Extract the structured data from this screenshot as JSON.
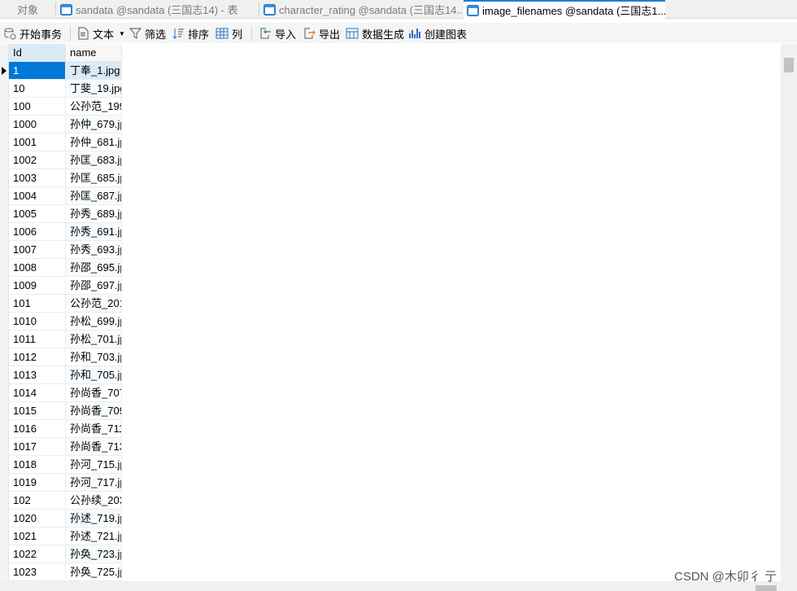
{
  "tabs": [
    {
      "label": "对象",
      "active": false,
      "icon": "none"
    },
    {
      "label": "sandata @sandata (三国志14) - 表",
      "active": false,
      "icon": "table-icon"
    },
    {
      "label": "character_rating @sandata (三国志14...",
      "active": false,
      "icon": "table-icon"
    },
    {
      "label": "image_filenames @sandata (三国志1...",
      "active": true,
      "icon": "table-icon"
    }
  ],
  "toolbar": {
    "begin_transaction": "开始事务",
    "text": "文本",
    "filter": "筛选",
    "sort": "排序",
    "columns": "列",
    "import": "导入",
    "export": "导出",
    "data_generation": "数据生成",
    "create_chart": "创建图表"
  },
  "grid": {
    "columns": [
      "Id",
      "name"
    ],
    "rows": [
      [
        "1",
        "丁奉_1.jpg"
      ],
      [
        "10",
        "丁斐_19.jpg"
      ],
      [
        "100",
        "公孙范_199"
      ],
      [
        "1000",
        "孙仲_679.jp"
      ],
      [
        "1001",
        "孙仲_681.jp"
      ],
      [
        "1002",
        "孙匡_683.jp"
      ],
      [
        "1003",
        "孙匡_685.jp"
      ],
      [
        "1004",
        "孙匡_687.jp"
      ],
      [
        "1005",
        "孙秀_689.jp"
      ],
      [
        "1006",
        "孙秀_691.jp"
      ],
      [
        "1007",
        "孙秀_693.jp"
      ],
      [
        "1008",
        "孙邵_695.jp"
      ],
      [
        "1009",
        "孙邵_697.jp"
      ],
      [
        "101",
        "公孙范_201"
      ],
      [
        "1010",
        "孙松_699.jp"
      ],
      [
        "1011",
        "孙松_701.jp"
      ],
      [
        "1012",
        "孙和_703.jp"
      ],
      [
        "1013",
        "孙和_705.jp"
      ],
      [
        "1014",
        "孙尚香_707"
      ],
      [
        "1015",
        "孙尚香_709"
      ],
      [
        "1016",
        "孙尚香_711"
      ],
      [
        "1017",
        "孙尚香_713"
      ],
      [
        "1018",
        "孙河_715.jp"
      ],
      [
        "1019",
        "孙河_717.jp"
      ],
      [
        "102",
        "公孙续_203"
      ],
      [
        "1020",
        "孙述_719.jp"
      ],
      [
        "1021",
        "孙述_721.jp"
      ],
      [
        "1022",
        "孙奂_723.jp"
      ],
      [
        "1023",
        "孙奂_725.jp"
      ]
    ]
  },
  "watermark": "CSDN @木卯彳 亍",
  "colors": {
    "accent": "#1a7fd7",
    "selected_cell": "#0078d7",
    "header_selected": "#dbeaf7"
  }
}
